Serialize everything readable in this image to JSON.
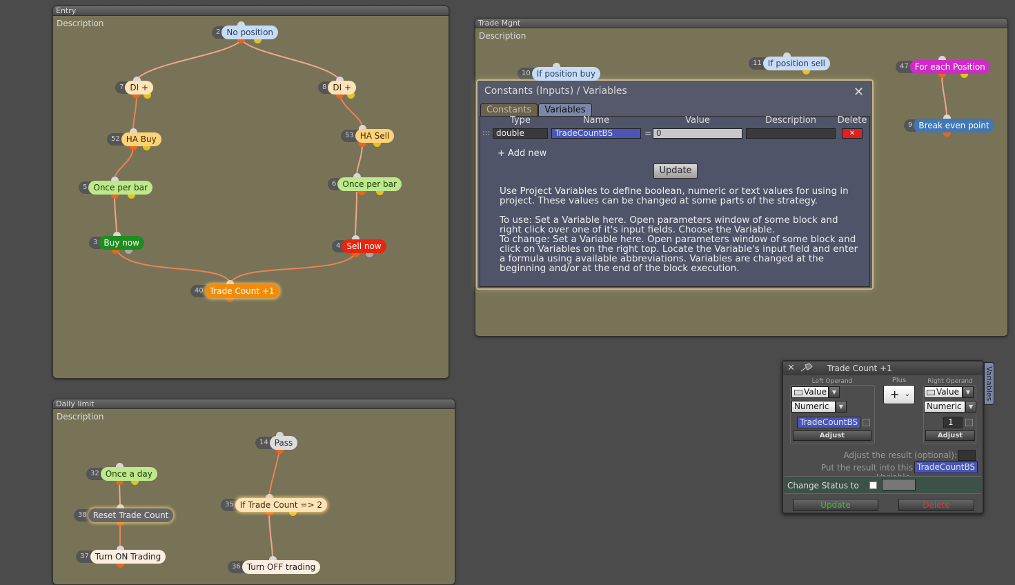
{
  "entry": {
    "title": "Entry",
    "description": "Description"
  },
  "trade_mgnt": {
    "title": "Trade Mgnt",
    "description": "Description"
  },
  "daily_limit": {
    "title": "Daily limit",
    "description": "Description"
  },
  "nodes": {
    "n2": {
      "num": "2",
      "label": "No position"
    },
    "n7": {
      "num": "7",
      "label": "DI +"
    },
    "n8": {
      "num": "8",
      "label": "DI +"
    },
    "n52": {
      "num": "52",
      "label": "HA Buy"
    },
    "n53": {
      "num": "53",
      "label": "HA Sell"
    },
    "n5": {
      "num": "5",
      "label": "Once per bar"
    },
    "n6": {
      "num": "6",
      "label": "Once per bar"
    },
    "n3": {
      "num": "3",
      "label": "Buy now"
    },
    "n4": {
      "num": "4",
      "label": "Sell now"
    },
    "n40": {
      "num": "40",
      "label": "Trade Count +1"
    },
    "n10": {
      "num": "10",
      "label": "If position buy"
    },
    "n11": {
      "num": "11",
      "label": "If position sell"
    },
    "n47": {
      "num": "47",
      "label": "For each Position"
    },
    "n9": {
      "num": "9",
      "label": "Break even point"
    },
    "n14": {
      "num": "14",
      "label": "Pass"
    },
    "n32": {
      "num": "32",
      "label": "Once a day"
    },
    "n35": {
      "num": "35",
      "label": "If Trade Count => 2"
    },
    "n38": {
      "num": "38",
      "label": "Reset Trade Count"
    },
    "n37": {
      "num": "37",
      "label": "Turn ON Trading"
    },
    "n36": {
      "num": "36",
      "label": "Turn OFF trading"
    }
  },
  "dialog": {
    "title": "Constants (Inputs) / Variables",
    "close": "✕",
    "tabs": [
      "Constants",
      "Variables"
    ],
    "columns": {
      "type": "Type",
      "name": "Name",
      "value": "Value",
      "description": "Description",
      "delete": "Delete"
    },
    "row": {
      "handle": ":::",
      "type": "double",
      "name": "TradeCountBS",
      "eq": "=",
      "value": "0",
      "description": "",
      "delete": "✕"
    },
    "add_new": "+ Add new",
    "update": "Update",
    "help": [
      "Use Project Variables to define boolean, numeric or text values for using in project. These values can be changed at some parts of the strategy.",
      "To use: Set a Variable here. Open parameters window of some block and right click over one of it's input fields. Choose the Variable.",
      "To change: Set a Variable here. Open parameters window of some block and click on Variables on the right top. Locate the Variable's input field and enter a formula using available abbreviations. Variables are changed at the beginning and/or at the end of the block execution."
    ]
  },
  "props": {
    "close": "✕",
    "title": "Trade Count +1",
    "left_operand": "Left Operand",
    "plus_label": "Plus",
    "right_operand": "Right Operand",
    "left_kind": "Value",
    "left_type": "Numeric",
    "left_var": "TradeCountBS",
    "right_kind": "Value",
    "right_type": "Numeric",
    "right_value": "1",
    "op": "+",
    "adjust": "Adjust",
    "adjust_result": "Adjust the result (optional):",
    "put_result": "Put the result into this Variable:",
    "result_var": "TradeCountBS",
    "change_status": "Change Status to",
    "update": "Update",
    "delete": "Delete",
    "variables_tab": "Variables"
  },
  "colors": {
    "canvas": "#4b4b4b",
    "group_bg": "#787357",
    "accent_var": "#4a55b5",
    "update_green": "#3dbb3d",
    "delete_red": "#d63a3a"
  }
}
